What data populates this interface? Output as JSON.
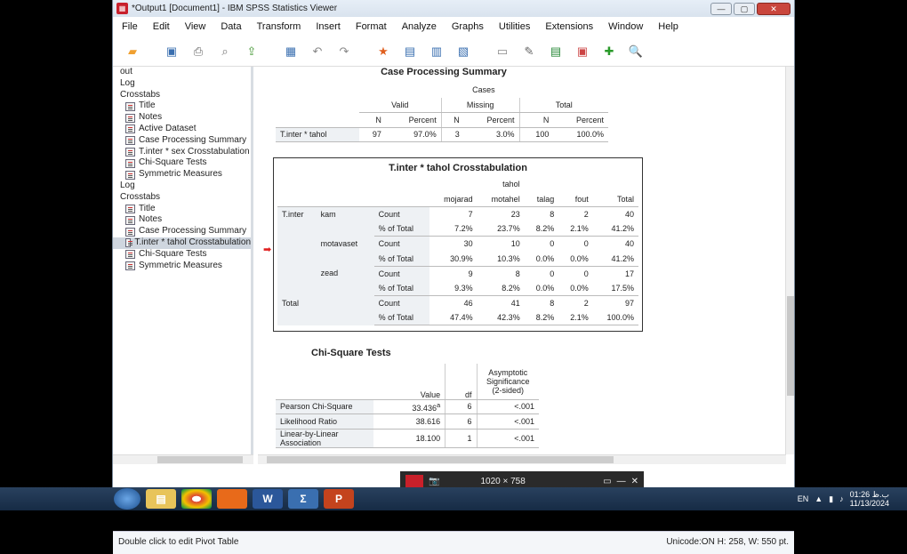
{
  "window": {
    "title": "*Output1 [Document1] - IBM SPSS Statistics Viewer",
    "btn_min": "—",
    "btn_max": "▢",
    "btn_close": "✕"
  },
  "menu": [
    "File",
    "Edit",
    "View",
    "Data",
    "Transform",
    "Insert",
    "Format",
    "Analyze",
    "Graphs",
    "Utilities",
    "Extensions",
    "Window",
    "Help"
  ],
  "toolbar_icons": [
    "open-folder-icon",
    "save-icon",
    "print-icon",
    "print-preview-icon",
    "export-icon",
    "dialog-recall-icon",
    "undo-icon",
    "redo-icon",
    "goto-data-icon",
    "goto-case-icon",
    "variables-icon",
    "select-cases-icon",
    "designate-window-icon",
    "insert-output-icon",
    "insert-heading-icon",
    "promote-icon",
    "add-icon",
    "search-icon"
  ],
  "outline": [
    {
      "label": "out",
      "indent": 0,
      "icon": false
    },
    {
      "label": "Log",
      "indent": 0,
      "icon": false
    },
    {
      "label": "Crosstabs",
      "indent": 0,
      "icon": false
    },
    {
      "label": "Title",
      "indent": 1,
      "icon": true
    },
    {
      "label": "Notes",
      "indent": 1,
      "icon": true
    },
    {
      "label": "Active Dataset",
      "indent": 1,
      "icon": true
    },
    {
      "label": "Case Processing Summary",
      "indent": 1,
      "icon": true
    },
    {
      "label": "T.inter * sex Crosstabulation",
      "indent": 1,
      "icon": true
    },
    {
      "label": "Chi-Square Tests",
      "indent": 1,
      "icon": true
    },
    {
      "label": "Symmetric Measures",
      "indent": 1,
      "icon": true
    },
    {
      "label": "Log",
      "indent": 0,
      "icon": false
    },
    {
      "label": "Crosstabs",
      "indent": 0,
      "icon": false
    },
    {
      "label": "Title",
      "indent": 1,
      "icon": true
    },
    {
      "label": "Notes",
      "indent": 1,
      "icon": true
    },
    {
      "label": "Case Processing Summary",
      "indent": 1,
      "icon": true
    },
    {
      "label": "T.inter * tahol Crosstabulation",
      "indent": 1,
      "icon": true,
      "selected": true
    },
    {
      "label": "Chi-Square Tests",
      "indent": 1,
      "icon": true
    },
    {
      "label": "Symmetric Measures",
      "indent": 1,
      "icon": true
    }
  ],
  "cps": {
    "title": "Case Processing Summary",
    "cases": "Cases",
    "groups": [
      "Valid",
      "Missing",
      "Total"
    ],
    "subheads": [
      "N",
      "Percent",
      "N",
      "Percent",
      "N",
      "Percent"
    ],
    "row_label": "T.inter * tahol",
    "values": [
      "97",
      "97.0%",
      "3",
      "3.0%",
      "100",
      "100.0%"
    ]
  },
  "ct": {
    "title": "T.inter * tahol Crosstabulation",
    "col_var": "tahol",
    "cols": [
      "mojarad",
      "motahel",
      "talag",
      "fout",
      "Total"
    ],
    "row_var": "T.inter",
    "groups": [
      {
        "name": "kam",
        "rows": [
          {
            "stat": "Count",
            "vals": [
              "7",
              "23",
              "8",
              "2",
              "40"
            ]
          },
          {
            "stat": "% of Total",
            "vals": [
              "7.2%",
              "23.7%",
              "8.2%",
              "2.1%",
              "41.2%"
            ]
          }
        ]
      },
      {
        "name": "motavaset",
        "rows": [
          {
            "stat": "Count",
            "vals": [
              "30",
              "10",
              "0",
              "0",
              "40"
            ]
          },
          {
            "stat": "% of Total",
            "vals": [
              "30.9%",
              "10.3%",
              "0.0%",
              "0.0%",
              "41.2%"
            ]
          }
        ]
      },
      {
        "name": "zead",
        "rows": [
          {
            "stat": "Count",
            "vals": [
              "9",
              "8",
              "0",
              "0",
              "17"
            ]
          },
          {
            "stat": "% of Total",
            "vals": [
              "9.3%",
              "8.2%",
              "0.0%",
              "0.0%",
              "17.5%"
            ]
          }
        ]
      }
    ],
    "total": {
      "name": "Total",
      "rows": [
        {
          "stat": "Count",
          "vals": [
            "46",
            "41",
            "8",
            "2",
            "97"
          ]
        },
        {
          "stat": "% of Total",
          "vals": [
            "47.4%",
            "42.3%",
            "8.2%",
            "2.1%",
            "100.0%"
          ]
        }
      ]
    }
  },
  "chi": {
    "title": "Chi-Square Tests",
    "h_value": "Value",
    "h_df": "df",
    "h_sig": "Asymptotic Significance (2-sided)",
    "rows": [
      {
        "label": "Pearson Chi-Square",
        "value": "33.436",
        "sup": "a",
        "df": "6",
        "sig": "<.001"
      },
      {
        "label": "Likelihood Ratio",
        "value": "38.616",
        "sup": "",
        "df": "6",
        "sig": "<.001"
      },
      {
        "label": "Linear-by-Linear Association",
        "value": "18.100",
        "sup": "",
        "df": "1",
        "sig": "<.001"
      }
    ]
  },
  "status": {
    "left": "Double click to edit Pivot Table",
    "right": "Unicode:ON  H: 258, W: 550 pt."
  },
  "overlay": {
    "size": "1020 × 758"
  },
  "tray": {
    "lang": "EN",
    "time": "01:26 ب.ظ",
    "date": "11/13/2024"
  }
}
